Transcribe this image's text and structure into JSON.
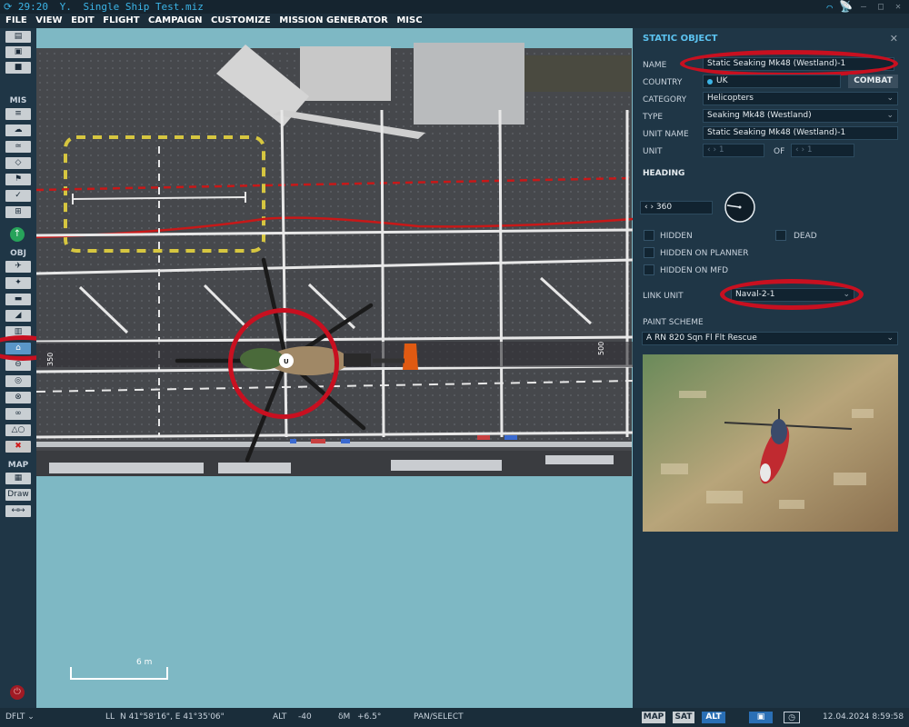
{
  "window": {
    "clock": "29:20",
    "prefix": "Y.",
    "filename": "Single Ship Test.miz"
  },
  "menu": [
    "FILE",
    "VIEW",
    "EDIT",
    "FLIGHT",
    "CAMPAIGN",
    "CUSTOMIZE",
    "MISSION GENERATOR",
    "MISC"
  ],
  "toolbar": {
    "section_mis": "MIS",
    "section_obj": "OBJ",
    "section_map": "MAP",
    "draw_label": "Draw"
  },
  "map": {
    "scale_label": "6 m",
    "deck_mark_left": "350",
    "deck_mark_right": "500",
    "helicopter_code": "U"
  },
  "panel": {
    "title": "STATIC OBJECT",
    "name_label": "NAME",
    "name_value": "Static Seaking Mk48 (Westland)-1",
    "country_label": "COUNTRY",
    "country_value": "UK",
    "combat_label": "COMBAT",
    "category_label": "CATEGORY",
    "category_value": "Helicopters",
    "type_label": "TYPE",
    "type_value": "Seaking Mk48 (Westland)",
    "unit_name_label": "UNIT NAME",
    "unit_name_value": "Static Seaking Mk48 (Westland)-1",
    "unit_label": "UNIT",
    "unit_value": "1",
    "of_label": "OF",
    "of_value": "1",
    "heading_label": "HEADING",
    "heading_value": "360",
    "hidden_label": "HIDDEN",
    "dead_label": "DEAD",
    "hidden_planner_label": "HIDDEN ON PLANNER",
    "hidden_mfd_label": "HIDDEN ON MFD",
    "link_unit_label": "LINK UNIT",
    "link_unit_value": "Naval-2-1",
    "paint_scheme_label": "PAINT SCHEME",
    "paint_scheme_value": "A RN 820 Sqn Fl Flt Rescue"
  },
  "status": {
    "dflt": "DFLT",
    "ll_label": "LL",
    "coords": "N 41°58'16\", E 41°35'06\"",
    "alt_label": "ALT",
    "alt_value": "-40",
    "dm_label": "δM",
    "dm_value": "+6.5°",
    "mode": "PAN/SELECT",
    "btn_map": "MAP",
    "btn_sat": "SAT",
    "btn_alt": "ALT",
    "datetime": "12.04.2024 8:59:58"
  },
  "colors": {
    "accent": "#3cb4e6",
    "panel_bg": "#1f3646",
    "highlight_ring": "#c81020",
    "sea": "#7eb8c4",
    "deck": "#4a4c50"
  }
}
